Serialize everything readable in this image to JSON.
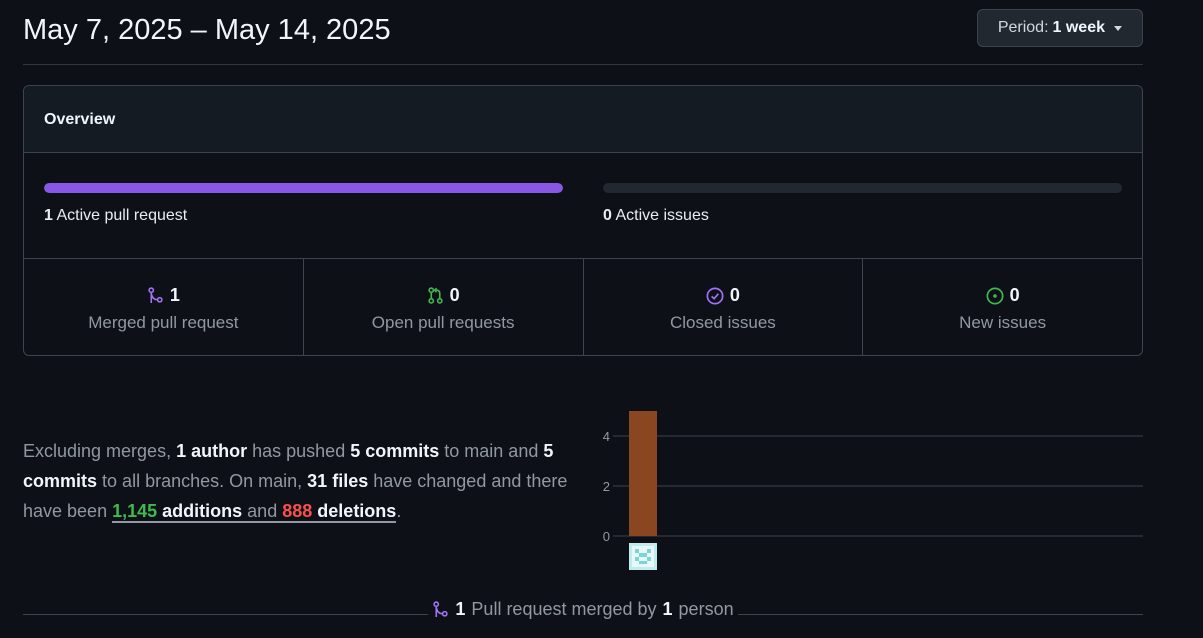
{
  "header": {
    "date_range": "May 7, 2025 – May 14, 2025",
    "period_prefix": "Period:",
    "period_value": "1 week"
  },
  "overview": {
    "title": "Overview",
    "pull_requests": {
      "count": "1",
      "label": "Active pull request",
      "fill_fraction": 1.0,
      "color": "#8957e5"
    },
    "issues": {
      "count": "0",
      "label": "Active issues",
      "fill_fraction": 0.0,
      "color": "#238636"
    },
    "stats": [
      {
        "icon": "merged-pr-icon",
        "value": "1",
        "label": "Merged pull request",
        "color": "#a371f7"
      },
      {
        "icon": "open-pr-icon",
        "value": "0",
        "label": "Open pull requests",
        "color": "#3fb950"
      },
      {
        "icon": "closed-issue-icon",
        "value": "0",
        "label": "Closed issues",
        "color": "#a371f7"
      },
      {
        "icon": "new-issue-icon",
        "value": "0",
        "label": "New issues",
        "color": "#3fb950"
      }
    ]
  },
  "summary": {
    "p1": "Excluding merges,",
    "authors": "1 author",
    "p2": "has pushed",
    "commits_main": "5 commits",
    "p3": "to main and",
    "commits_all": "5 commits",
    "p4": "to all branches. On main,",
    "files": "31 files",
    "p5": "have changed and there have been",
    "additions_num": "1,145",
    "additions_word": "additions",
    "and": "and",
    "deletions_num": "888",
    "deletions_word": "deletions",
    "end": "."
  },
  "chart_data": {
    "type": "bar",
    "categories": [
      "author"
    ],
    "values": [
      5
    ],
    "ylim": [
      0,
      5
    ],
    "yticks": [
      "0",
      "2",
      "4"
    ],
    "grid": true,
    "bar_color": "#8a4621"
  },
  "footer": {
    "count": "1",
    "text": "Pull request merged by",
    "people": "1",
    "people_word": "person"
  }
}
